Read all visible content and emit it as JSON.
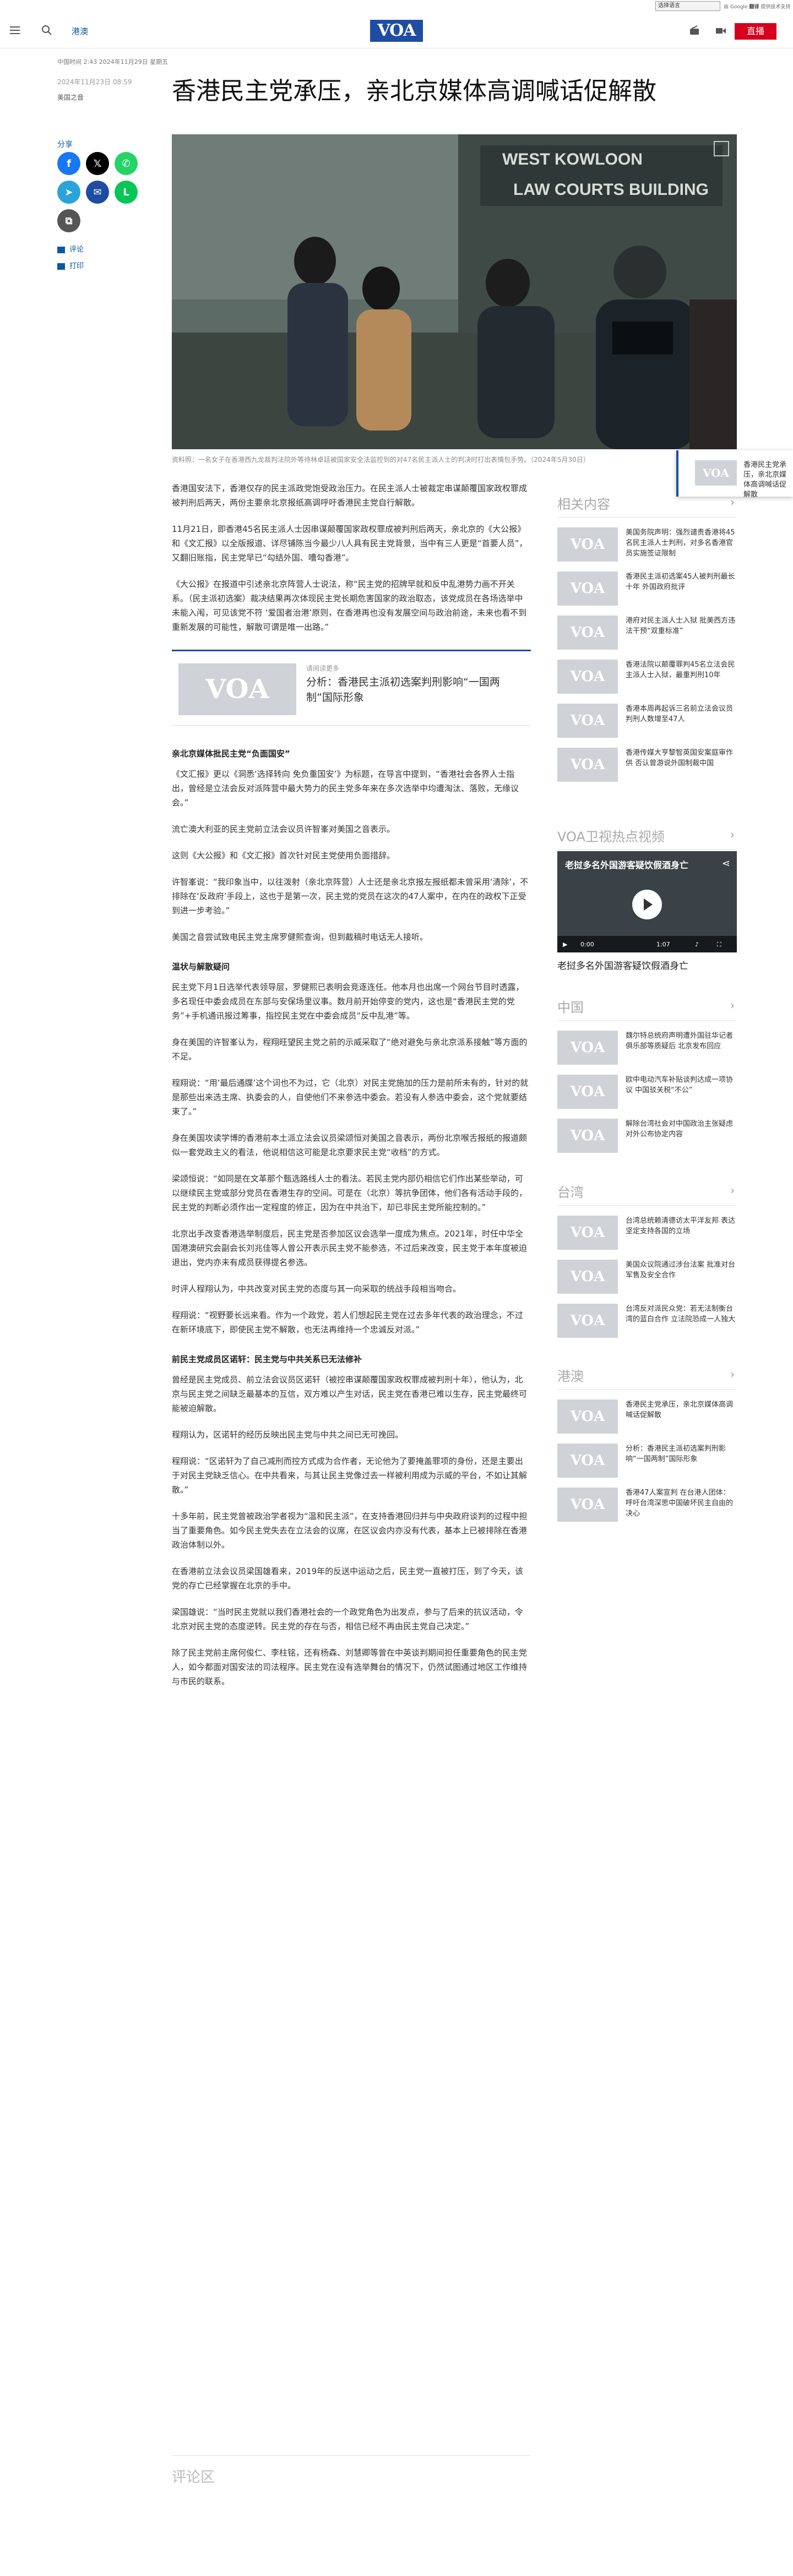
{
  "topbar": {
    "language_select": "选择语言",
    "powered_by": "由 Google",
    "powered_service": "翻译",
    "powered_suffix": "提供技术支持"
  },
  "header": {
    "section": "港澳",
    "logo": "VOA",
    "live_label": "直播"
  },
  "article": {
    "meta_top": "中国时间 2:43 2024年11月29日 星期五",
    "published": "2024年11月23日 08:59",
    "author": "美国之音",
    "title": "香港民主党承压，亲北京媒体高调喊话促解散",
    "share_label": "分享",
    "comments_link": "评论",
    "print_link": "打印",
    "image_caption": "资料照：一名女子在香港西九龙裁判法院外等待林卓廷被国家安全法监控到的对47名民主派人士的判决时打出表情包手势。（2024年5月30日）",
    "paragraphs": [
      "香港国安法下，香港仅存的民主派政党饱受政治压力。在民主派人士被裁定串谋颠覆国家政权罪成被判刑后两天，两份主要亲北京报纸高调呼吁香港民主党自行解散。",
      "11月21日，即香港45名民主派人士因串谋颠覆国家政权罪成被判刑后两天，亲北京的《大公报》和《文汇报》以全版报道、详尽铺陈当今最少八人具有民主党背景，当中有三人更是“首要人员”，又翻旧账指，民主党早已“勾结外国、嘈勾香港”。",
      "《大公报》在报道中引述亲北京阵营人士说法，称“民主党的招牌早就和反中乱港势力画不开关系。（民主派初选案）裁决结果再次体现民主党长期危害国家的政治取态，该党成员在各场选举中未能入闱，可见该党不符 ‘爱国者治港’原则，在香港再也没有发展空间与政治前途，未来也看不到重新发展的可能性，解散可谓是唯一出路。”"
    ],
    "related_inline": {
      "label": "请阅读更多",
      "title": "分析：香港民主派初选案判刑影响“一国两制”国际形象"
    },
    "paragraphs_2": [
      "亲北京媒体批民主党“负面国安”",
      "《文汇报》更以《洞悉‘选择转向 免负重国安’》为标题，在导言中提到，“香港社会各界人士指出，曾经是立法会反对派阵营中最大势力的民主党多年来在多次选举中均遭淘汰、落败，无缘议会。”",
      "流亡澳大利亚的民主党前立法会议员许智峯对美国之音表示。",
      "这则《大公报》和《文汇报》首次针对民主党使用负面措辞。",
      "许智峯说：“我印象当中，以往泼射（亲北京阵营）人士还是亲北京报左报纸都未曾采用‘清除’，不排除在‘反政府’手段上，这也于是第一次，民主党的党员在这次的47人案中，在内在的政权下正受到进一步考验。”",
      "美国之音尝试致电民主党主席罗健熙查询，但到截稿时电话无人接听。"
    ],
    "paragraphs_3": [
      "温状与解散疑问",
      "民主党下月1日选举代表领导层，罗健熙已表明会竞逐连任。他本月也出席一个网台节目时透露，多名现任中委会成员在东部与安保场里议事。数月前开始停变的党内，这也是“香港民主党的党务”+手机通讯报过筹事，指控民主党在中委会成员“反中乱港”等。",
      "身在美国的许智峯认为，程翔旺望民主党之前的示威采取了“绝对避免与亲北京派系接触”等方面的不足。",
      "程翔说：“用‘最后通牒’这个词也不为过，它（北京）对民主党施加的压力是前所未有的，针对的就是那些出来选主席、执委会的人，自使他们不来参选中委会。若没有人参选中委会，这个党就要结束了。”",
      "身在美国攻读学博的香港前本土派立法会议员梁颂恒对美国之音表示，两份北京喉舌报纸的报道颇似一套党政主义的看法，他说相信这可能是北京要求民主党“收档”的方式。",
      "梁颂恒说：“如同是在文革那个甄选路线人士的看法。若民主党内部仍相信它们作出某些举动，可以继续民主党或部分党员在香港生存的空间。可是在（北京）等抗争团体，他们各有活动手段的，民主党的判断必须作出一定程度的修正，因为在中共治下，却已非民主党所能控制的。”",
      "北京出手改变香港选举制度后，民主党是否参加区议会选举一度成为焦点。2021年，时任中华全国港澳研究会副会长刘兆佳等人曾公开表示民主党不能参选，不过后来改变，民主党于本年度被迫退出，党内亦未有成员获得提名参选。",
      "时评人程翔认为，中共改变对民主党的态度与其一向采取的统战手段相当吻合。",
      "程翔说：“视野要长远来看。作为一个政党，若人们想起民主党在过去多年代表的政治理念，不过在新环境底下，即使民主党不解散，也无法再维持一个忠诚反对派。”"
    ],
    "paragraphs_4": [
      "前民主党成员区诺轩：民主党与中共关系已无法修补",
      "曾经是民主党成员、前立法会议员区诺轩（被控串谋颠覆国家政权罪成被判刑十年），他认为，北京与民主党之间缺乏最基本的互信，双方难以产生对话，民主党在香港已难以生存，民主党最终可能被迫解散。",
      "程翔认为，区诺轩的经历反映出民主党与中共之间已无可挽回。",
      "程翔说：“区诺轩为了自己减刑而控方式成为合作者，无论他为了要掩盖罪项的身份，还是主要出于对民主党缺乏信心。在中共看来，与其让民主党像过去一样被利用成为示威的平台，不如让其解散。”",
      "十多年前，民主党曾被政治学者视为“温和民主派”，在支持香港回归并与中央政府谈判的过程中担当了重要角色。如今民主党失去在立法会的议席，在区议会内亦没有代表，基本上已被排除在香港政治体制以外。",
      "在香港前立法会议员梁国雄看来，2019年的反送中运动之后，民主党一直被打压，到了今天，该党的存亡已经掌握在北京的手中。",
      "梁国雄说：“当时民主党就以我们香港社会的一个政党角色为出发点，参与了后来的抗议活动，令北京对民主党的态度逆转。民主党的存在与否，相信已经不再由民主党自己决定。”",
      "除了民主党前主席何俊仁、李柱铭，还有杨森、刘慧卿等曾在中英谈判期间担任重要角色的民主党人，如今都面对国安法的司法程序。民主党在没有选举舞台的情况下，仍然试图通过地区工作维持与市民的联系。"
    ],
    "comments_heading": "评论区"
  },
  "sidebar": {
    "related_heading": "相关内容",
    "related_items": [
      "美国务院声明：强烈谴责香港将45名民主派人士判刑，对多名香港官员实施签证限制",
      "香港民主派初选案45人被判刑最长十年 外国政府批评",
      "港府对民主派人士入狱 批美西方违法干预“双重标准”",
      "香港法院以颠覆罪判45名立法会民主派人士入狱，最重判刑10年",
      "香港本周再起诉三名前立法会议员判刑人数增至47人",
      "香港传媒大亨黎智英国安案庭审作供 否认曾游说外国制裁中国"
    ],
    "video_heading": "VOA卫视热点视频",
    "video": {
      "title": "老挝多名外国游客疑饮假酒身亡",
      "time_current": "0:00",
      "time_total": "1:07",
      "caption": "老挝多名外国游客疑饮假酒身亡"
    },
    "china_heading": "中国",
    "china_items": [
      "魏尔特总统府声明遭外国驻华记者俱乐部等质疑后 北京发布回应",
      "欧中电动汽车补贴谈判达成一项协议 中国驳关税“不公”",
      "解除台湾社会对中国政治主张疑虑 对外公布协定内容"
    ],
    "taiwan_heading": "台湾",
    "taiwan_items": [
      "台湾总统赖清德访太平洋友邦 表达坚定支持各国的立场",
      "美国众议院通过涉台法案 批准对台军售及安全合作",
      "台湾反对派民众党：若无法制衡台湾的蓝白合作 立法院恐成一人独大"
    ],
    "hk_heading": "港澳",
    "hk_items": [
      "香港民主党承压，亲北京媒体高调喊话促解散",
      "分析：香港民主派初选案判刑影响“一国两制”国际形象",
      "香港47人案宣判 在台港人团体：呼吁台湾深思中国破坏民主自由的决心"
    ]
  },
  "sticky_card": {
    "logo": "VOA",
    "text": "香港民主党承压，亲北京媒体高调喊话促解散"
  },
  "colors": {
    "brand_blue": "#1f4da1",
    "live_red": "#d6001c",
    "link_blue": "#0a57a4"
  }
}
